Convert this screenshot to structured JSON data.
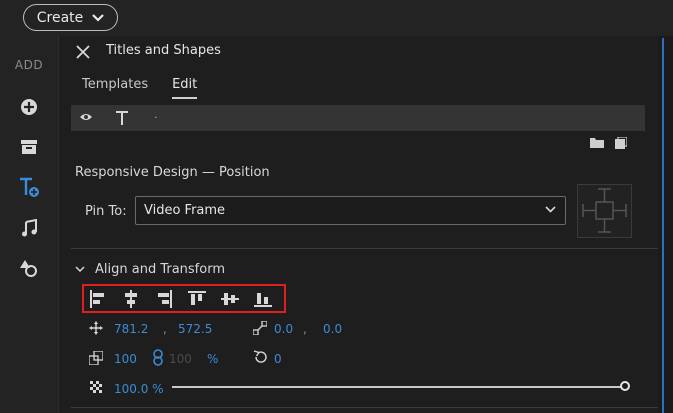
{
  "topbar": {
    "create_label": "Create"
  },
  "rail": {
    "add_label": "ADD"
  },
  "panel": {
    "title": "Titles and Shapes",
    "tabs": [
      {
        "label": "Templates",
        "selected": false
      },
      {
        "label": "Edit",
        "selected": true
      }
    ],
    "toolstrip_dot": "."
  },
  "responsive": {
    "section_label": "Responsive Design — Position",
    "pin_to_label": "Pin To:",
    "pin_to_value": "Video Frame"
  },
  "align": {
    "header": "Align and Transform",
    "buttons": [
      "align-left",
      "align-horizontal-center",
      "align-right",
      "align-top",
      "align-vertical-center",
      "align-bottom"
    ]
  },
  "transform": {
    "position_x": "781.2",
    "position_y": "572.5",
    "sep": ",",
    "anchor_x": "0.0",
    "anchor_y": "0.0",
    "scale_w": "100",
    "scale_h": "100",
    "scale_unit": "%",
    "rotation": "0",
    "opacity": "100.0 %",
    "opacity_fraction": 1.0
  },
  "colors": {
    "accent_blue": "#3b8bd6",
    "highlight_red": "#e0201e",
    "panel_bg": "#1e1e1e"
  }
}
